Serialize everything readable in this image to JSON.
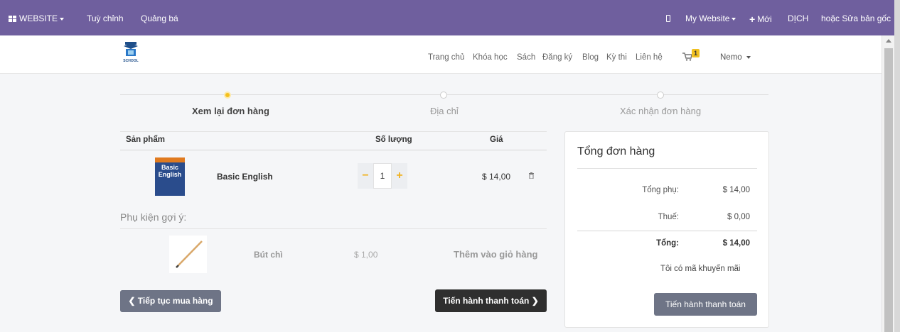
{
  "topbar": {
    "website_menu": "WEBSITE",
    "customize": "Tuỳ chỉnh",
    "promote": "Quảng bá",
    "my_website": "My Website",
    "new": "Mới",
    "translate": "DỊCH",
    "or_edit": "hoặc Sửa bản gốc"
  },
  "navbar": {
    "logo_text": "SCHOOL",
    "links": [
      "Trang chủ",
      "Khóa học",
      "Sách",
      "Đăng ký",
      "Blog",
      "Kỳ thi",
      "Liên hệ"
    ],
    "cart_count": "1",
    "user": "Nemo"
  },
  "steps": [
    {
      "label": "Xem lại đơn hàng",
      "active": true
    },
    {
      "label": "Địa chỉ",
      "active": false
    },
    {
      "label": "Xác nhận đơn hàng",
      "active": false
    }
  ],
  "cart": {
    "headers": {
      "product": "Sản phẩm",
      "qty": "Số lượng",
      "price": "Giá"
    },
    "item": {
      "cover_line1": "Basic",
      "cover_line2": "English",
      "name": "Basic English",
      "qty": "1",
      "price": "$ 14,00"
    }
  },
  "suggestions": {
    "title": "Phụ kiện gợi ý:",
    "item": {
      "name": "Bút chì",
      "price": "$ 1,00",
      "add": "Thêm vào giỏ hàng"
    }
  },
  "buttons": {
    "continue": "Tiếp tục mua hàng",
    "checkout": "Tiến hành thanh toán"
  },
  "summary": {
    "title": "Tổng đơn hàng",
    "subtotal_label": "Tổng phụ:",
    "subtotal": "$ 14,00",
    "tax_label": "Thuế:",
    "tax": "$ 0,00",
    "total_label": "Tổng:",
    "total": "$ 14,00",
    "promo": "Tôi có mã khuyến mãi",
    "checkout": "Tiến hành thanh toán"
  },
  "colors": {
    "topbar": "#6f5f9e",
    "accent": "#f4c01e"
  }
}
